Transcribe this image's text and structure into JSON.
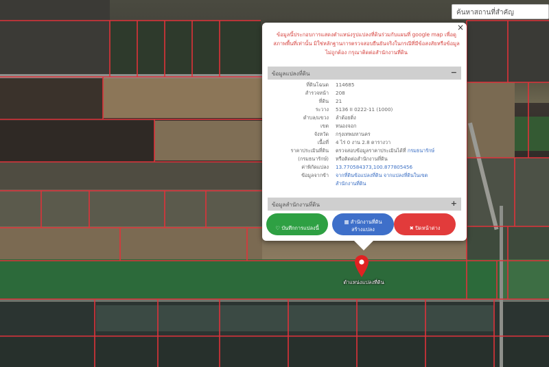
{
  "search": {
    "placeholder": "ค้นหาสถานที่สำคัญ"
  },
  "popup": {
    "notice": "ข้อมูลนี้ประกอบการแสดงตำแหน่งรูปแปลงที่ดินร่วมกับแผนที่ google map เพื่อดูสภาพพื้นที่เท่านั้น มิใช่หลักฐานการตรวจสอบยืนยันจริงในกรณีที่มีข้อสงสัยหรือข้อมูลไม่ถูกต้อง กรุณาติดต่อสำนักงานที่ดิน",
    "close_symbol": "×",
    "section_parcel": {
      "title": "ข้อมูลแปลงที่ดิน",
      "toggle": "−"
    },
    "section_office": {
      "title": "ข้อมูลสำนักงานที่ดิน",
      "toggle": "+"
    },
    "fields": [
      {
        "key": "ที่ดินโฉนด",
        "value": "114685"
      },
      {
        "key": "สำรวจหน้า",
        "value": "208"
      },
      {
        "key": "ที่ดิน",
        "value": "21"
      },
      {
        "key": "ระวาง",
        "value": "5136 II 0222-11 (1000)"
      },
      {
        "key": "ตำบล/แขวง",
        "value": "ลำต้อยติ่ง"
      },
      {
        "key": "เขต",
        "value": "หนองจอก"
      },
      {
        "key": "จังหวัด",
        "value": "กรุงเทพมหานคร"
      },
      {
        "key": "เนื้อที่",
        "value": "4 ไร่ 0 งาน 2.8 ตารางวา"
      }
    ],
    "appraisal": {
      "key_line1": "ราคาประเมินที่ดิน",
      "key_line2": "(กรมธนารักษ์)",
      "value_text": "ตรวจสอบข้อมูลราคาประเมินได้ที่ ",
      "value_link": "กรมธนารักษ์",
      "value_line2": "หรือติดต่อสำนักงานที่ดิน"
    },
    "coords": {
      "key": "ค่าพิกัดแปลง",
      "value": "13.770584373,100.877805456"
    },
    "source": {
      "key": "ข้อมูลจากข้า",
      "value_line1": "จากที่ดินข้อแปลงที่ดิน จากแปลงที่ดินในเขต",
      "value_line2": "สำนักงานที่ดิน"
    },
    "buttons": {
      "save": {
        "icon": "♡",
        "label": "บันทึกการแปลงนี้"
      },
      "office": {
        "icon": "▦",
        "label_line1": "สำนักงานที่ดิน",
        "label_line2": "สร้างแปลง"
      },
      "close": {
        "icon": "✖",
        "label": "ปิดหน้าต่าง"
      }
    }
  },
  "pin": {
    "label": "ตำแหน่งแปลงที่ดิน",
    "color": "#e02222"
  },
  "colors": {
    "accent_red": "#d64541",
    "green": "#2ea043",
    "blue": "#3e6fc9",
    "red": "#e23b3b"
  }
}
